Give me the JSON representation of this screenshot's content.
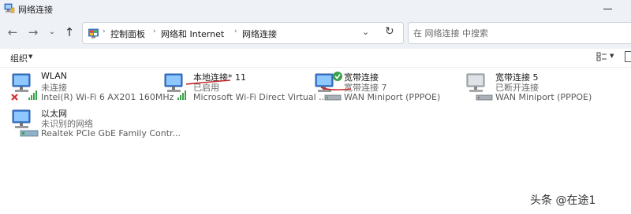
{
  "window": {
    "title": "网络连接"
  },
  "nav": {
    "back_icon": "arrow-left-icon",
    "forward_icon": "arrow-right-icon",
    "history_icon": "chevron-down-icon",
    "up_icon": "arrow-up-icon"
  },
  "breadcrumb": {
    "location_icon": "control-panel-icon",
    "items": [
      "控制面板",
      "网络和 Internet",
      "网络连接"
    ]
  },
  "search": {
    "placeholder": "在 网络连接 中搜索"
  },
  "toolbar": {
    "organize_label": "组织"
  },
  "connections": [
    {
      "name": "WLAN",
      "status": "未连接",
      "device": "Intel(R) Wi-Fi 6 AX201 160MHz",
      "icon": "wifi-adapter-icon",
      "state": "disconnected"
    },
    {
      "name": "本地连接* 11",
      "status": "已启用",
      "device": "Microsoft Wi-Fi Direct Virtual ...",
      "icon": "wifi-adapter-icon",
      "state": "enabled"
    },
    {
      "name": "宽带连接",
      "status": "宽带连接 7",
      "device": "WAN Miniport (PPPOE)",
      "icon": "broadband-icon",
      "state": "connected"
    },
    {
      "name": "宽带连接 5",
      "status": "已断开连接",
      "device": "WAN Miniport (PPPOE)",
      "icon": "broadband-icon",
      "state": "disconnected"
    },
    {
      "name": "以太网",
      "status": "未识别的网络",
      "device": "Realtek PCIe GbE Family Contr...",
      "icon": "ethernet-adapter-icon",
      "state": "enabled"
    }
  ],
  "watermark": "头条 @在途1",
  "colors": {
    "chrome_bg": "#eef1f6",
    "signal_green": "#3aa14a",
    "error_red": "#d32f2f",
    "annotation_red": "#c62828"
  }
}
